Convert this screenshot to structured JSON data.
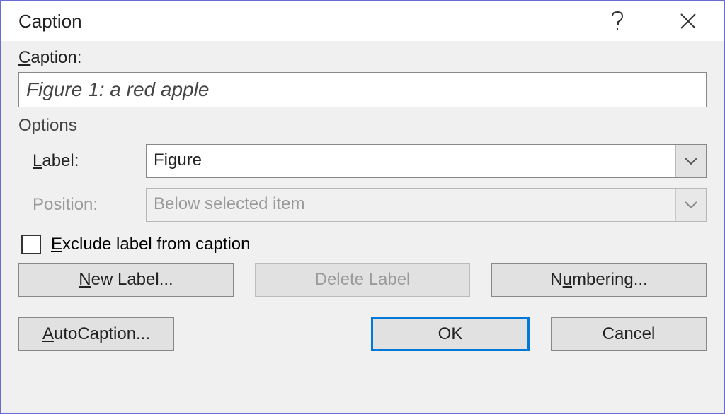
{
  "title": "Caption",
  "captionLabel": "aption:",
  "captionValue": "Figure 1: a red apple",
  "options": {
    "header": "Options",
    "labelLabel_pre": "",
    "labelLabel_u": "L",
    "labelLabel_post": "abel:",
    "labelValue": "Figure",
    "positionLabel": "Position:",
    "positionValue": "Below selected item"
  },
  "exclude": {
    "pre": "",
    "u": "E",
    "post": "xclude label from caption"
  },
  "buttons": {
    "newLabel_pre": "",
    "newLabel_u": "N",
    "newLabel_post": "ew Label...",
    "deleteLabel": "Delete Label",
    "numbering_pre": "N",
    "numbering_u": "u",
    "numbering_post": "mbering...",
    "autoCaption_pre": "",
    "autoCaption_u": "A",
    "autoCaption_post": "utoCaption...",
    "ok": "OK",
    "cancel": "Cancel"
  }
}
